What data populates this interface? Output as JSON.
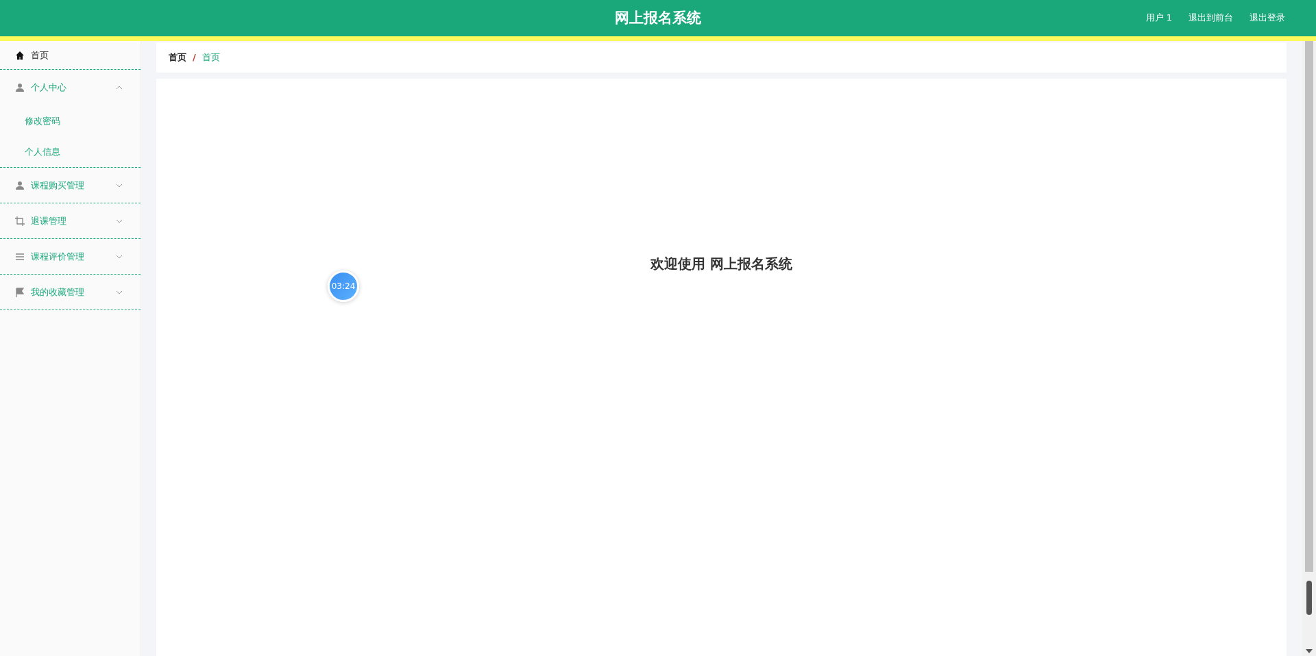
{
  "header": {
    "title": "网上报名系统",
    "links": [
      "用户 1",
      "退出到前台",
      "退出登录"
    ]
  },
  "sidebar": {
    "items": [
      {
        "kind": "link",
        "label": "首页",
        "selected": true
      },
      {
        "kind": "group",
        "label": "个人中心",
        "selected": false,
        "expanded": true,
        "children": [
          {
            "label": "修改密码",
            "selected": false
          },
          {
            "label": "个人信息",
            "selected": false
          }
        ]
      },
      {
        "kind": "group",
        "label": "课程购买管理",
        "selected": false,
        "expanded": false
      },
      {
        "kind": "group",
        "label": "退课管理",
        "selected": false,
        "expanded": false
      },
      {
        "kind": "group",
        "label": "课程评价管理",
        "selected": false,
        "expanded": false
      },
      {
        "kind": "group",
        "label": "我的收藏管理",
        "selected": false,
        "expanded": false
      }
    ]
  },
  "breadcrumb": {
    "separator": "/",
    "items": [
      "首页",
      "首页"
    ]
  },
  "welcome": "欢迎使用 网上报名系统",
  "timer": "03:24"
}
